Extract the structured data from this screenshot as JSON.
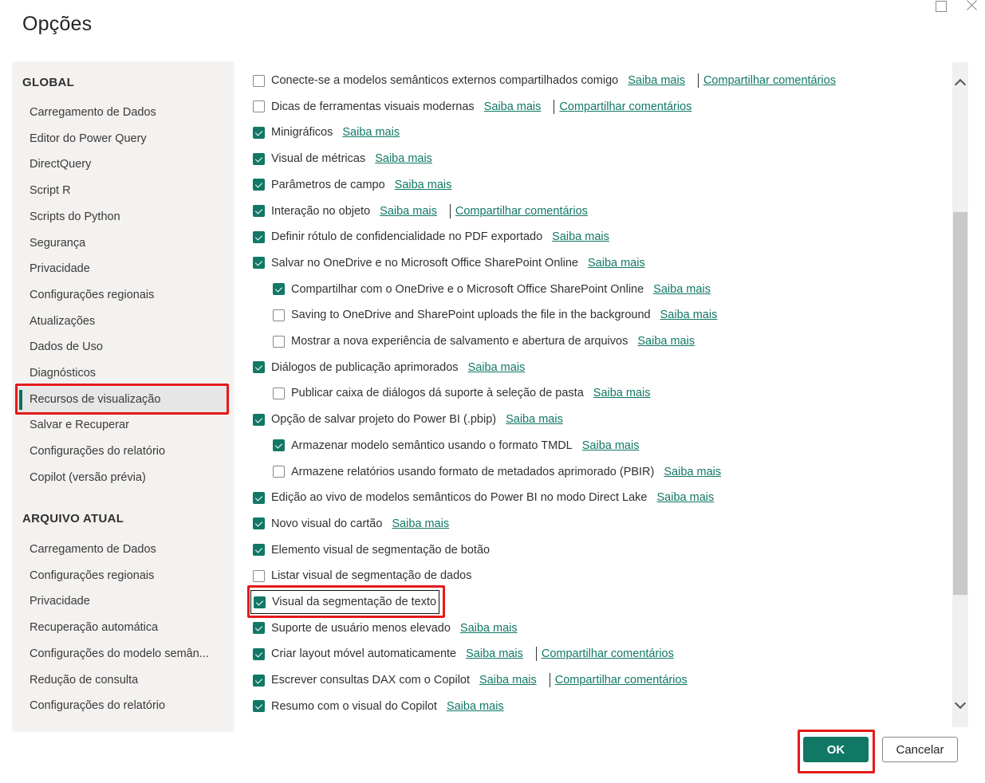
{
  "window": {
    "title": "Opções",
    "maximize_icon": "maximize-icon",
    "close_icon": "close-icon"
  },
  "sidebar": {
    "global": {
      "heading": "GLOBAL",
      "items": [
        {
          "label": "Carregamento de Dados"
        },
        {
          "label": "Editor do Power Query"
        },
        {
          "label": "DirectQuery"
        },
        {
          "label": "Script R"
        },
        {
          "label": "Scripts do Python"
        },
        {
          "label": "Segurança"
        },
        {
          "label": "Privacidade"
        },
        {
          "label": "Configurações regionais"
        },
        {
          "label": "Atualizações"
        },
        {
          "label": "Dados de Uso"
        },
        {
          "label": "Diagnósticos"
        },
        {
          "label": "Recursos de visualização",
          "selected": true
        },
        {
          "label": "Salvar e Recuperar"
        },
        {
          "label": "Configurações do relatório"
        },
        {
          "label": "Copilot (versão prévia)"
        }
      ]
    },
    "current_file": {
      "heading": "ARQUIVO ATUAL",
      "items": [
        {
          "label": "Carregamento de Dados"
        },
        {
          "label": "Configurações regionais"
        },
        {
          "label": "Privacidade"
        },
        {
          "label": "Recuperação automática"
        },
        {
          "label": "Configurações do modelo semân..."
        },
        {
          "label": "Redução de consulta"
        },
        {
          "label": "Configurações do relatório"
        }
      ]
    }
  },
  "links": {
    "learn_more": "Saiba mais",
    "share_feedback": "Compartilhar comentários"
  },
  "options": [
    {
      "label": "Conecte-se a modelos semânticos externos compartilhados comigo",
      "checked": false,
      "indent": 0,
      "learn_more": true,
      "feedback": true
    },
    {
      "label": "Dicas de ferramentas visuais modernas",
      "checked": false,
      "indent": 0,
      "learn_more": true,
      "feedback": true
    },
    {
      "label": "Minigráficos",
      "checked": true,
      "indent": 0,
      "learn_more": true,
      "feedback": false
    },
    {
      "label": "Visual de métricas",
      "checked": true,
      "indent": 0,
      "learn_more": true,
      "feedback": false
    },
    {
      "label": "Parâmetros de campo",
      "checked": true,
      "indent": 0,
      "learn_more": true,
      "feedback": false
    },
    {
      "label": "Interação no objeto",
      "checked": true,
      "indent": 0,
      "learn_more": true,
      "feedback": true
    },
    {
      "label": "Definir rótulo de confidencialidade no PDF exportado",
      "checked": true,
      "indent": 0,
      "learn_more": true,
      "feedback": false
    },
    {
      "label": "Salvar no OneDrive e no Microsoft Office SharePoint Online",
      "checked": true,
      "indent": 0,
      "learn_more": true,
      "feedback": false
    },
    {
      "label": "Compartilhar com o OneDrive e o Microsoft Office SharePoint Online",
      "checked": true,
      "indent": 1,
      "learn_more": true,
      "feedback": false
    },
    {
      "label": "Saving to OneDrive and SharePoint uploads the file in the background",
      "checked": false,
      "indent": 1,
      "learn_more": true,
      "feedback": false
    },
    {
      "label": "Mostrar a nova experiência de salvamento e abertura de arquivos",
      "checked": false,
      "indent": 1,
      "learn_more": true,
      "feedback": false
    },
    {
      "label": "Diálogos de publicação aprimorados",
      "checked": true,
      "indent": 0,
      "learn_more": true,
      "feedback": false
    },
    {
      "label": "Publicar caixa de diálogos dá suporte à seleção de pasta",
      "checked": false,
      "indent": 1,
      "learn_more": true,
      "feedback": false
    },
    {
      "label": "Opção de salvar projeto do Power BI (.pbip)",
      "checked": true,
      "indent": 0,
      "learn_more": true,
      "feedback": false
    },
    {
      "label": "Armazenar modelo semântico usando o formato TMDL",
      "checked": true,
      "indent": 1,
      "learn_more": true,
      "feedback": false
    },
    {
      "label": "Armazene relatórios usando formato de metadados aprimorado (PBIR)",
      "checked": false,
      "indent": 1,
      "learn_more": true,
      "feedback": false
    },
    {
      "label": "Edição ao vivo de modelos semânticos do Power BI no modo Direct Lake",
      "checked": true,
      "indent": 0,
      "learn_more": true,
      "feedback": false
    },
    {
      "label": "Novo visual do cartão",
      "checked": true,
      "indent": 0,
      "learn_more": true,
      "feedback": false
    },
    {
      "label": "Elemento visual de segmentação de botão",
      "checked": true,
      "indent": 0,
      "learn_more": false,
      "feedback": false
    },
    {
      "label": "Listar visual de segmentação de dados",
      "checked": false,
      "indent": 0,
      "learn_more": false,
      "feedback": false
    },
    {
      "label": "Visual da segmentação de texto",
      "checked": true,
      "indent": 0,
      "learn_more": false,
      "feedback": false,
      "focused": true
    },
    {
      "label": "Suporte de usuário menos elevado",
      "checked": true,
      "indent": 0,
      "learn_more": true,
      "feedback": false
    },
    {
      "label": "Criar layout móvel automaticamente",
      "checked": true,
      "indent": 0,
      "learn_more": true,
      "feedback": true
    },
    {
      "label": "Escrever consultas DAX com o Copilot",
      "checked": true,
      "indent": 0,
      "learn_more": true,
      "feedback": true
    },
    {
      "label": "Resumo com o visual do Copilot",
      "checked": true,
      "indent": 0,
      "learn_more": true,
      "feedback": false
    }
  ],
  "scrollbar": {
    "position_fraction": 0.3,
    "up_icon": "chevron-up-icon",
    "down_icon": "chevron-down-icon"
  },
  "footer": {
    "ok_label": "OK",
    "cancel_label": "Cancelar"
  },
  "highlight_color": "#e41a1a",
  "accent_color": "#117865"
}
